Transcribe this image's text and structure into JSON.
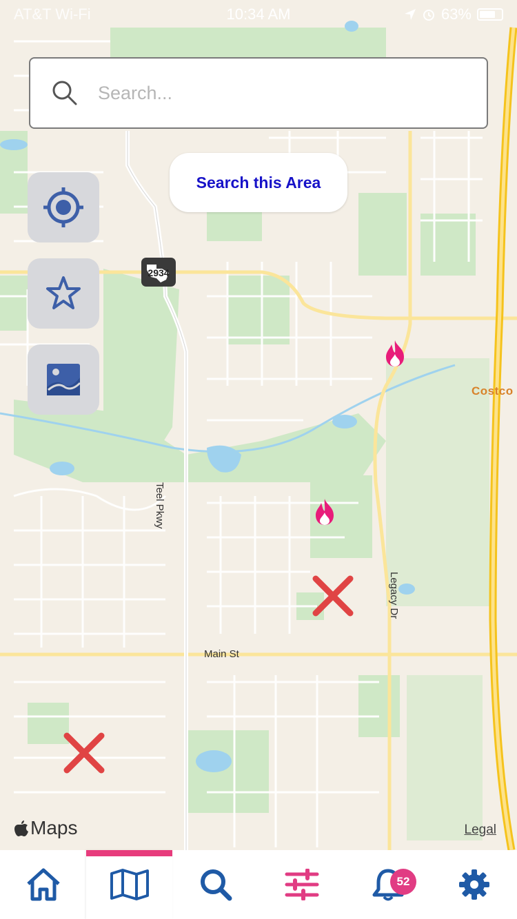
{
  "status_bar": {
    "carrier": "AT&T Wi-Fi",
    "time": "10:34 AM",
    "battery": "63%"
  },
  "search": {
    "placeholder": "Search..."
  },
  "search_area_button": "Search this Area",
  "side_buttons": [
    "locate-icon",
    "star-icon",
    "image-icon"
  ],
  "map": {
    "highway_shield": "2934",
    "labels": {
      "teel": "Teel Pkwy",
      "legacy": "Legacy Dr",
      "main": "Main St",
      "costco": "Costco"
    },
    "attribution": "Maps",
    "legal": "Legal"
  },
  "markers": [
    {
      "type": "fire-icon"
    },
    {
      "type": "fire-icon"
    },
    {
      "type": "x-icon"
    },
    {
      "type": "x-icon"
    }
  ],
  "tab_bar": {
    "tabs": [
      "home-icon",
      "map-icon",
      "search-icon",
      "filter-icon",
      "bell-icon",
      "gear-icon"
    ],
    "active_tab": "map",
    "notification_count": "52"
  },
  "colors": {
    "accent_blue": "#1f5aa6",
    "accent_pink": "#e73b7c",
    "search_area_text": "#1712c8",
    "marker_red": "#e04444"
  }
}
